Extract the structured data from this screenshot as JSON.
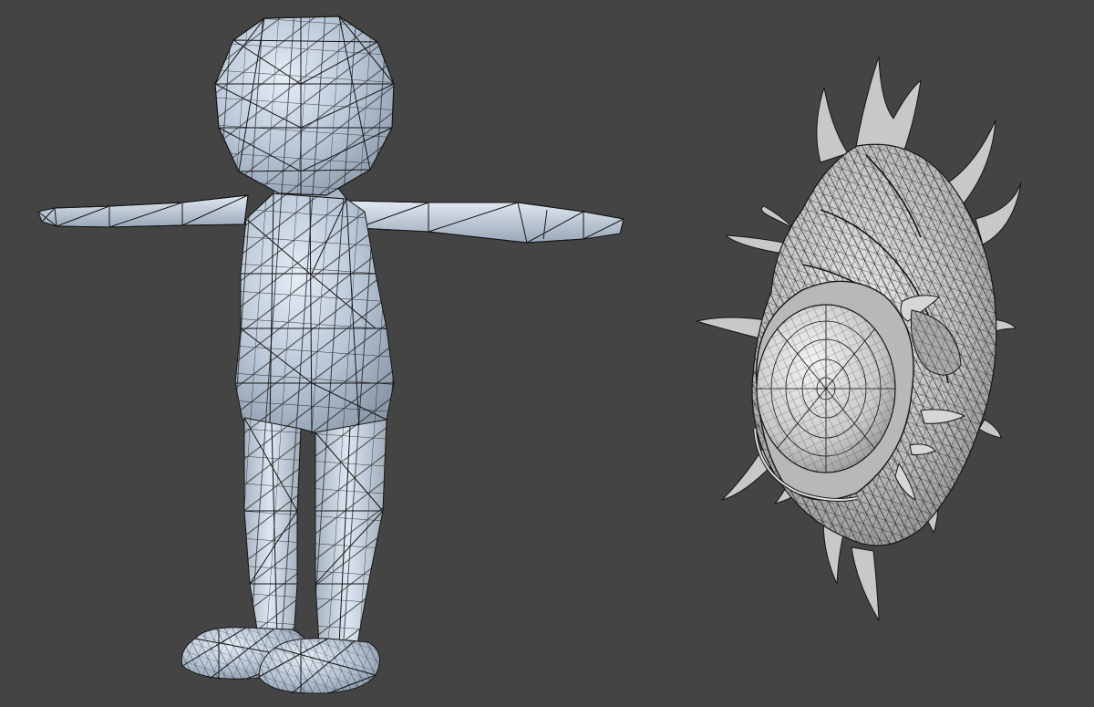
{
  "viewport": {
    "background": "#444444",
    "shading": "wireframe-on-shaded",
    "objects": [
      {
        "name": "low-poly-character",
        "shade": "#c4d0de",
        "wire": "#161616"
      },
      {
        "name": "spiked-shell-creature",
        "shade": "#cfcfcf",
        "wire": "#161616"
      }
    ]
  }
}
